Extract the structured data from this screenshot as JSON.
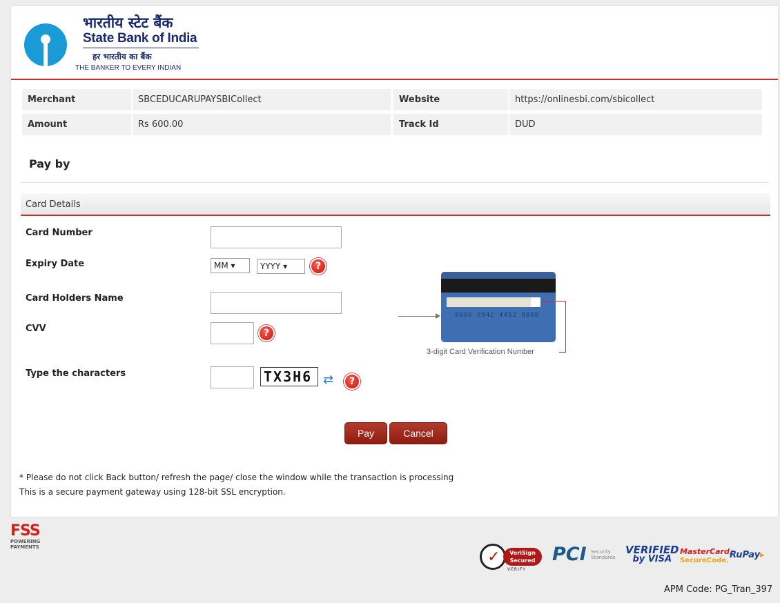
{
  "header": {
    "bank_name_hindi": "भारतीय स्टेट बैंक",
    "bank_name": "State Bank of India",
    "tagline_hindi": "हर भारतीय का बैंक",
    "tagline": "THE BANKER TO EVERY INDIAN"
  },
  "transaction": {
    "merchant_label": "Merchant",
    "merchant_value": "SBCEDUCARUPAYSBICollect",
    "website_label": "Website",
    "website_value": "https://onlinesbi.com/sbicollect",
    "amount_label": "Amount",
    "amount_value": "Rs 600.00",
    "track_label": "Track Id",
    "track_value": "DUD"
  },
  "pay_by": "Pay by",
  "card_details": {
    "section_title": "Card Details",
    "card_number_label": "Card Number",
    "card_number_value": "",
    "expiry_label": "Expiry Date",
    "expiry_month": "MM",
    "expiry_year": "YYYY",
    "holder_label": "Card Holders Name",
    "holder_value": "",
    "cvv_label": "CVV",
    "cvv_value": "",
    "captcha_label": "Type the characters",
    "captcha_value": "",
    "captcha_text": "TX3H6",
    "card_digits": "0000 0042 4452 0000",
    "cvv_caption": "3-digit Card Verification Number"
  },
  "buttons": {
    "pay": "Pay",
    "cancel": "Cancel"
  },
  "notes": {
    "warning": "* Please do not click Back button/ refresh the page/ close the window while the transaction is processing",
    "secure": "This is a secure payment gateway using 128-bit SSL encryption."
  },
  "footer": {
    "fss_logo": "FSS",
    "fss_tag_line1": "POWERING",
    "fss_tag_line2": "PAYMENTS",
    "verisign_line1": "VeriSign",
    "verisign_line2": "Secured",
    "verisign_verify": "VERIFY",
    "pci": "PCI",
    "pci_small_line1": "Security",
    "pci_small_line2": "Standards",
    "vbv_line1": "VERIFIED",
    "vbv_line2": "by VISA",
    "mastercard_line1": "MasterCard.",
    "mastercard_line2": "SecureCode.",
    "rupay": "RuPay",
    "apm_code": "APM Code: PG_Tran_397"
  },
  "colors": {
    "accent_red": "#c9302c",
    "button_red": "#9b2417",
    "sbi_blue": "#1a9bd7",
    "navy": "#1b2a6b"
  },
  "icons": {
    "help": "question-circle",
    "refresh": "refresh-arrows"
  }
}
